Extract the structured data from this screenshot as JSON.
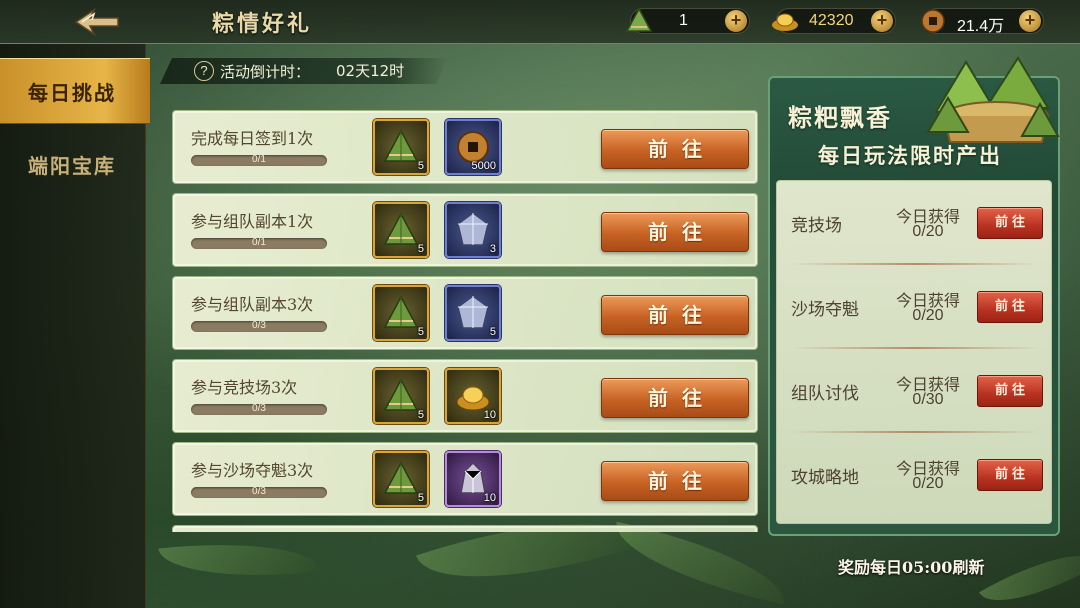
{
  "header": {
    "title": "粽情好礼",
    "resources": [
      {
        "icon": "zongzi-icon",
        "value": "1"
      },
      {
        "icon": "gold-ingot-icon",
        "value": "42320"
      },
      {
        "icon": "copper-coin-icon",
        "value": "21.4万"
      }
    ]
  },
  "sidebar": {
    "tabs": [
      {
        "label": "每日挑战",
        "active": true
      },
      {
        "label": "端阳宝库",
        "active": false
      }
    ]
  },
  "countdown": {
    "label": "活动倒计时：",
    "value": "02天12时"
  },
  "tasks": [
    {
      "name": "完成每日签到1次",
      "progress": "0/1",
      "rewards": [
        {
          "icon": "zongzi-icon",
          "count": "5"
        },
        {
          "icon": "copper-coin-icon",
          "count": "5000"
        }
      ],
      "button": "前往"
    },
    {
      "name": "参与组队副本1次",
      "progress": "0/1",
      "rewards": [
        {
          "icon": "zongzi-icon",
          "count": "5"
        },
        {
          "icon": "silver-crystal-icon",
          "count": "3"
        }
      ],
      "button": "前往"
    },
    {
      "name": "参与组队副本3次",
      "progress": "0/3",
      "rewards": [
        {
          "icon": "zongzi-icon",
          "count": "5"
        },
        {
          "icon": "silver-crystal-icon",
          "count": "5"
        }
      ],
      "button": "前往"
    },
    {
      "name": "参与竞技场3次",
      "progress": "0/3",
      "rewards": [
        {
          "icon": "zongzi-icon",
          "count": "5"
        },
        {
          "icon": "gold-ingot-icon",
          "count": "10"
        }
      ],
      "button": "前往"
    },
    {
      "name": "参与沙场夺魁3次",
      "progress": "0/3",
      "rewards": [
        {
          "icon": "zongzi-icon",
          "count": "5"
        },
        {
          "icon": "purple-ore-icon",
          "count": "10"
        }
      ],
      "button": "前往"
    }
  ],
  "panel": {
    "title": "粽粑飘香",
    "subtitle": "每日玩法限时产出",
    "rows": [
      {
        "mode": "竞技场",
        "label": "今日获得",
        "count": "0/20",
        "button": "前往"
      },
      {
        "mode": "沙场夺魁",
        "label": "今日获得",
        "count": "0/20",
        "button": "前往"
      },
      {
        "mode": "组队讨伐",
        "label": "今日获得",
        "count": "0/30",
        "button": "前往"
      },
      {
        "mode": "攻城略地",
        "label": "今日获得",
        "count": "0/20",
        "button": "前往"
      }
    ]
  },
  "footer": {
    "refresh": "奖励每日05:00刷新"
  },
  "colors": {
    "accent_gold": "#e7b548",
    "button_orange": "#c76224",
    "button_red": "#b93221",
    "panel_green": "#2d5a44"
  }
}
